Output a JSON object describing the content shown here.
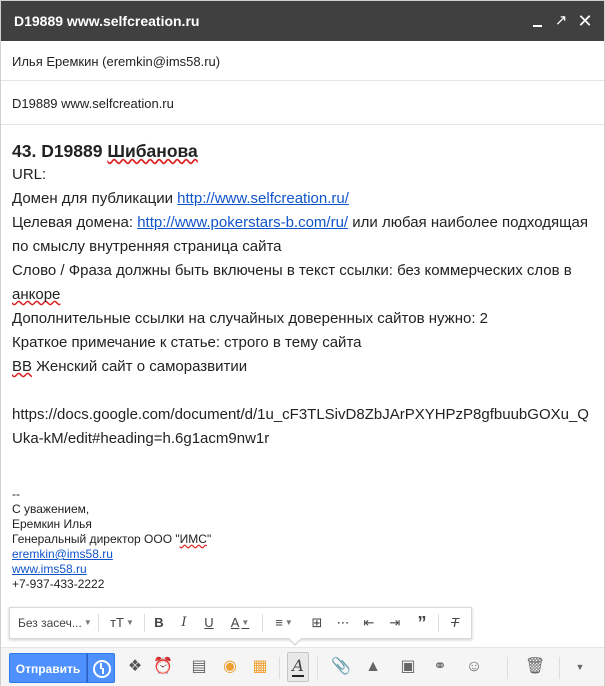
{
  "window": {
    "title": "D19889 www.selfcreation.ru"
  },
  "header": {
    "recipient": "Илья Еремкин (eremkin@ims58.ru)",
    "subject": "D19889 www.selfcreation.ru"
  },
  "body": {
    "heading_num": "43. D19889 ",
    "heading_name": "Шибанова",
    "line_url": "URL:",
    "domain_label": "Домен для публикации ",
    "domain_link": "http://www.selfcreation.ru/",
    "target_label": "Целевая домена: ",
    "target_link": "http://www.pokerstars-b.com/ru/",
    "target_rest": " или любая наиболее подходящая по смыслу внутренняя страница сайта",
    "phrase_main": "Слово / Фраза должны быть включены в текст ссылки: без коммерческих слов в ",
    "phrase_word": "анкоре",
    "extra_links": "Дополнительные ссылки на случайных доверенных сайтов нужно: 2",
    "note": "Краткое примечание к статье: строго в тему сайта",
    "bb_abbr": "ВВ",
    "bb_rest": " Женский сайт о саморазвитии",
    "doc_link": "https://docs.google.com/document/d/1u_cF3TLSivD8ZbJArPXYHPzP8gfbuubGOXu_QUka-kM/edit#heading=h.6g1acm9nw1r"
  },
  "signature": {
    "dashes": "--",
    "regards": "С уважением,",
    "name": "Еремкин Илья",
    "position_pre": "Генеральный директор ООО \"",
    "position_org": "ИМС",
    "position_post": "\"",
    "email": "eremkin@ims58.ru",
    "site": "www.ims58.ru",
    "phone": "+7-937-433-2222"
  },
  "format_toolbar": {
    "font_select": "Без засеч...",
    "size_icon": "тТ",
    "bold": "B",
    "italic": "I",
    "underline": "U",
    "color": "A"
  },
  "bottom_bar": {
    "send_label": "Отправить"
  },
  "colors": {
    "titlebar": "#404040",
    "send": "#4d90fe",
    "link": "#1155cc"
  }
}
